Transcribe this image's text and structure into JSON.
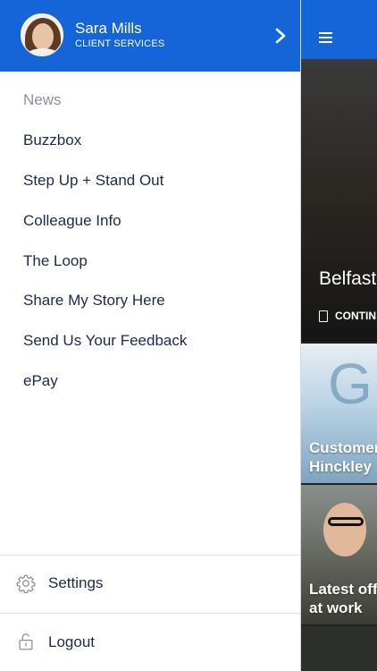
{
  "colors": {
    "header_blue": "#1565d8",
    "text_dark": "#1e2a4a",
    "text_muted": "#8c9099"
  },
  "drawer": {
    "user": {
      "name": "Sara Mills",
      "role": "CLIENT SERVICES"
    },
    "nav_items": [
      {
        "label": "News",
        "state": "current"
      },
      {
        "label": "Buzzbox"
      },
      {
        "label": "Step Up + Stand Out"
      },
      {
        "label": "Colleague Info"
      },
      {
        "label": "The Loop"
      },
      {
        "label": "Share My Story Here"
      },
      {
        "label": "Send Us Your Feedback"
      },
      {
        "label": "ePay"
      }
    ],
    "footer": {
      "settings_label": "Settings",
      "logout_label": "Logout"
    }
  },
  "background_app": {
    "hero_title": "Belfast",
    "hero_cta": "CONTIN",
    "cards": [
      {
        "caption_line1": "Customer",
        "caption_line2": "Hinckley"
      },
      {
        "caption_line1": "Latest offe",
        "caption_line2": "at work"
      }
    ]
  }
}
